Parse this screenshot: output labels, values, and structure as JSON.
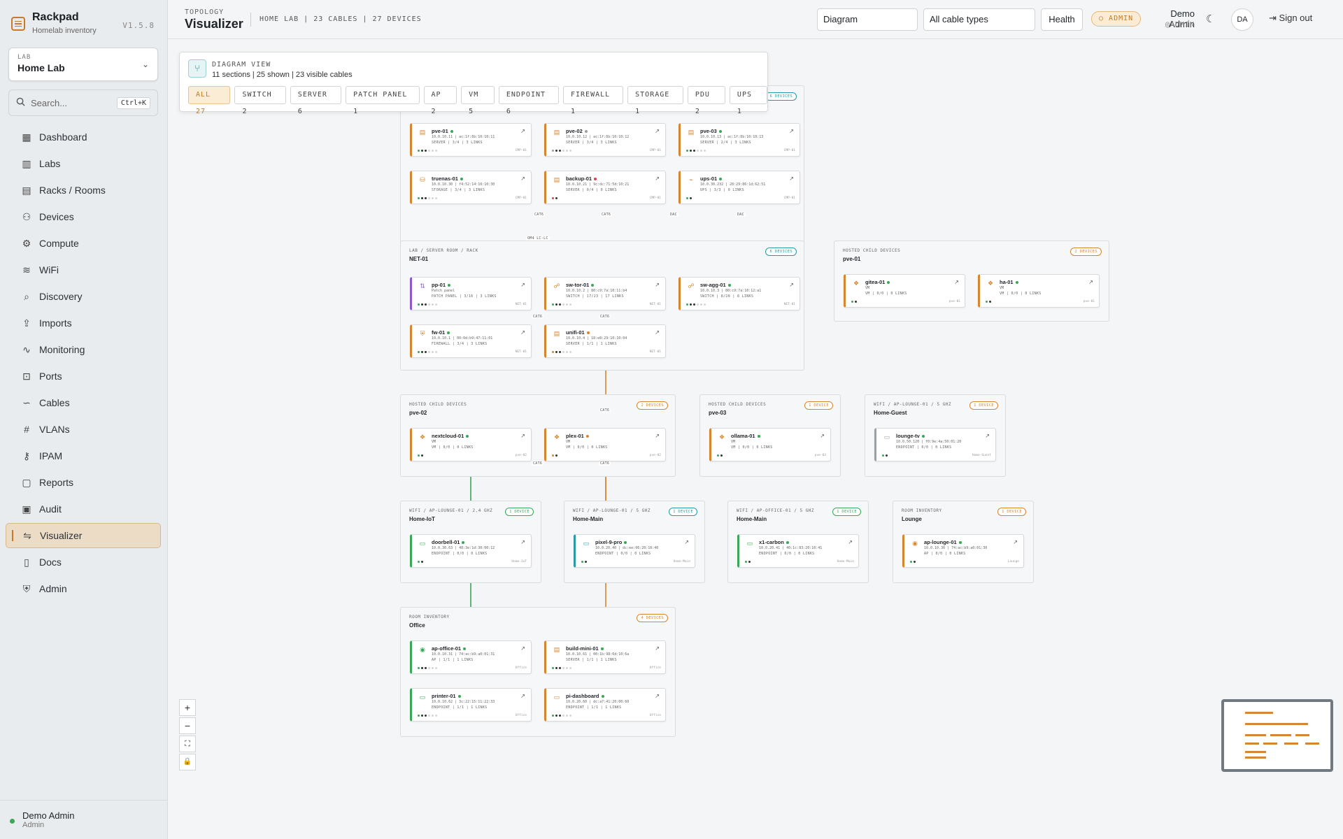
{
  "app": {
    "name": "Rackpad",
    "subtitle": "Homelab inventory",
    "version": "V1.5.8"
  },
  "lab": {
    "label": "LAB",
    "value": "Home Lab"
  },
  "search": {
    "placeholder": "Search...",
    "shortcut": "Ctrl+K"
  },
  "nav": [
    {
      "label": "Dashboard",
      "icon": "dashboard-icon"
    },
    {
      "label": "Labs",
      "icon": "building-icon"
    },
    {
      "label": "Racks / Rooms",
      "icon": "rack-icon"
    },
    {
      "label": "Devices",
      "icon": "devices-icon"
    },
    {
      "label": "Compute",
      "icon": "compute-icon"
    },
    {
      "label": "WiFi",
      "icon": "wifi-icon"
    },
    {
      "label": "Discovery",
      "icon": "search-icon"
    },
    {
      "label": "Imports",
      "icon": "import-icon"
    },
    {
      "label": "Monitoring",
      "icon": "activity-icon"
    },
    {
      "label": "Ports",
      "icon": "port-icon"
    },
    {
      "label": "Cables",
      "icon": "cable-icon"
    },
    {
      "label": "VLANs",
      "icon": "hash-icon"
    },
    {
      "label": "IPAM",
      "icon": "network-icon"
    },
    {
      "label": "Reports",
      "icon": "report-icon"
    },
    {
      "label": "Audit",
      "icon": "audit-icon"
    },
    {
      "label": "Visualizer",
      "icon": "visualizer-icon",
      "active": true
    },
    {
      "label": "Docs",
      "icon": "book-icon"
    },
    {
      "label": "Admin",
      "icon": "shield-icon"
    }
  ],
  "footer_user": {
    "name": "Demo Admin",
    "role": "Admin"
  },
  "header": {
    "crumb": "TOPOLOGY",
    "title": "Visualizer",
    "meta": "HOME LAB | 23 CABLES | 27 DEVICES",
    "view_select": "Diagram",
    "cable_select": "All cable types",
    "health_label": "Health",
    "role_badge": "ADMIN",
    "user_name": "Demo Admin",
    "user_handle": "@ADMIN",
    "avatar": "DA",
    "signout": "Sign out"
  },
  "diagram_panel": {
    "kicker": "DIAGRAM VIEW",
    "summary": "11 sections | 25 shown | 23 visible cables",
    "chips": [
      "ALL 27",
      "SWITCH 2",
      "SERVER 6",
      "PATCH PANEL 1",
      "AP 2",
      "VM 5",
      "ENDPOINT 6",
      "FIREWALL 1",
      "STORAGE 1",
      "PDU 2",
      "UPS 1"
    ]
  },
  "sections": [
    {
      "id": "cmp",
      "tag": "",
      "title": "",
      "badge": "6 DEVICES",
      "color": "#2a9aa0"
    },
    {
      "id": "net",
      "tag": "LAB / SERVER ROOM / RACK",
      "title": "NET-01",
      "badge": "6 DEVICES",
      "color": "#2a9aa0"
    },
    {
      "id": "h1",
      "tag": "HOSTED CHILD DEVICES",
      "title": "pve-01",
      "badge": "2 DEVICES",
      "color": "#d5862f"
    },
    {
      "id": "h2",
      "tag": "HOSTED CHILD DEVICES",
      "title": "pve-02",
      "badge": "2 DEVICES",
      "color": "#d5862f"
    },
    {
      "id": "h3",
      "tag": "HOSTED CHILD DEVICES",
      "title": "pve-03",
      "badge": "1 DEVICE",
      "color": "#d5862f"
    },
    {
      "id": "wg",
      "tag": "WIFI / AP-LOUNGE-01 / 5 GHZ",
      "title": "Home-Guest",
      "badge": "1 DEVICE",
      "color": "#d5862f"
    },
    {
      "id": "wi",
      "tag": "WIFI / AP-LOUNGE-01 / 2.4 GHZ",
      "title": "Home-IoT",
      "badge": "1 DEVICE",
      "color": "#3aa657"
    },
    {
      "id": "wm",
      "tag": "WIFI / AP-LOUNGE-01 / 5 GHZ",
      "title": "Home-Main",
      "badge": "1 DEVICE",
      "color": "#2a9aa0"
    },
    {
      "id": "wo",
      "tag": "WIFI / AP-OFFICE-01 / 5 GHZ",
      "title": "Home-Main",
      "badge": "1 DEVICE",
      "color": "#3aa657"
    },
    {
      "id": "rl",
      "tag": "ROOM INVENTORY",
      "title": "Lounge",
      "badge": "1 DEVICE",
      "color": "#d5862f"
    },
    {
      "id": "ro",
      "tag": "ROOM INVENTORY",
      "title": "Office",
      "badge": "4 DEVICES",
      "color": "#d5862f"
    }
  ],
  "devices": [
    {
      "name": "pve-01",
      "ip": "10.0.10.11 | ac:1f:6b:10:10:11",
      "meta": "SERVER | 3/4 | 3 LINKS",
      "loc": "CMP-01",
      "status": "#3aa657",
      "accent": "#d5862f",
      "icon": "▤"
    },
    {
      "name": "pve-02",
      "ip": "10.0.10.12 | ac:1f:6b:10:10:12",
      "meta": "SERVER | 3/4 | 3 LINKS",
      "loc": "CMP-01",
      "status": "#9aa0a6",
      "accent": "#d5862f",
      "icon": "▤"
    },
    {
      "name": "pve-03",
      "ip": "10.0.10.13 | ac:1f:6b:10:10:13",
      "meta": "SERVER | 2/4 | 3 LINKS",
      "loc": "CMP-01",
      "status": "#3aa657",
      "accent": "#d5862f",
      "icon": "▤"
    },
    {
      "name": "truenas-01",
      "ip": "10.0.10.30 | f4:52:14:10:10:30",
      "meta": "STORAGE | 3/4 | 3 LINKS",
      "loc": "CMP-01",
      "status": "#3aa657",
      "accent": "#d5862f",
      "icon": "⛁"
    },
    {
      "name": "backup-01",
      "ip": "10.0.10.21 | 9c:dc:71:5d:10:21",
      "meta": "SERVER | 0/4 | 0 LINKS",
      "loc": "CMP-01",
      "status": "#d64545",
      "accent": "#d5862f",
      "icon": "▤"
    },
    {
      "name": "ups-01",
      "ip": "10.0.30.232 | 28:29:86:1d:62:51",
      "meta": "UPS | 3/3 | 0 LINKS",
      "loc": "CMP-01",
      "status": "#3aa657",
      "accent": "#d5862f",
      "icon": "⌁"
    },
    {
      "name": "pp-01",
      "ip": "Patch panel",
      "meta": "PATCH PANEL | 3/16 | 3 LINKS",
      "loc": "NET-01",
      "status": "#3aa657",
      "accent": "#9057c9",
      "icon": "⇅"
    },
    {
      "name": "sw-tor-01",
      "ip": "10.0.10.2 | 80:c9:7a:10:11:b4",
      "meta": "SWITCH | 17/23 | 17 LINKS",
      "loc": "NET-01",
      "status": "#3aa657",
      "accent": "#d5862f",
      "icon": "☍"
    },
    {
      "name": "sw-agg-01",
      "ip": "10.0.10.3 | 80:c9:7a:10:12:a1",
      "meta": "SWITCH | 8/28 | 8 LINKS",
      "loc": "NET-01",
      "status": "#3aa657",
      "accent": "#d5862f",
      "icon": "☍"
    },
    {
      "name": "fw-01",
      "ip": "10.0.10.1 | 00:0d:b9:47:11:01",
      "meta": "FIREWALL | 3/4 | 3 LINKS",
      "loc": "NET-01",
      "status": "#3aa657",
      "accent": "#d5862f",
      "icon": "⛨"
    },
    {
      "name": "unifi-01",
      "ip": "10.0.10.4 | 18:e8:29:10:10:04",
      "meta": "SERVER | 1/1 | 1 LINKS",
      "loc": "NET-01",
      "status": "#d5862f",
      "accent": "#d5862f",
      "icon": "▤"
    },
    {
      "name": "gitea-01",
      "ip": "VM",
      "meta": "VM | 0/0 | 0 LINKS",
      "loc": "pve-01",
      "status": "#3aa657",
      "accent": "#d5862f",
      "icon": "❖"
    },
    {
      "name": "ha-01",
      "ip": "VM",
      "meta": "VM | 0/0 | 0 LINKS",
      "loc": "pve-01",
      "status": "#3aa657",
      "accent": "#d5862f",
      "icon": "❖"
    },
    {
      "name": "nextcloud-01",
      "ip": "VM",
      "meta": "VM | 0/0 | 0 LINKS",
      "loc": "pve-02",
      "status": "#3aa657",
      "accent": "#d5862f",
      "icon": "❖"
    },
    {
      "name": "plex-01",
      "ip": "VM",
      "meta": "VM | 0/0 | 0 LINKS",
      "loc": "pve-02",
      "status": "#d5862f",
      "accent": "#d5862f",
      "icon": "❖"
    },
    {
      "name": "ollama-01",
      "ip": "VM",
      "meta": "VM | 0/0 | 0 LINKS",
      "loc": "pve-03",
      "status": "#3aa657",
      "accent": "#d5862f",
      "icon": "❖"
    },
    {
      "name": "lounge-tv",
      "ip": "10.0.50.120 | f0:9e:4a:50:01:20",
      "meta": "ENDPOINT | 0/0 | 0 LINKS",
      "loc": "Home-Guest",
      "status": "#3aa657",
      "accent": "#9aa0a6",
      "icon": "▭"
    },
    {
      "name": "doorbell-01",
      "ip": "10.0.30.63 | 48:3e:1d:30:00:12",
      "meta": "ENDPOINT | 0/0 | 0 LINKS",
      "loc": "Home-IoT",
      "status": "#3aa657",
      "accent": "#3aa657",
      "icon": "▭"
    },
    {
      "name": "pixel-9-pro",
      "ip": "10.0.20.40 | dc:ee:06:20:10:40",
      "meta": "ENDPOINT | 0/0 | 0 LINKS",
      "loc": "Home-Main",
      "status": "#3aa657",
      "accent": "#2a9aa0",
      "icon": "▭"
    },
    {
      "name": "x1-carbon",
      "ip": "10.0.20.41 | 40:1c:83:20:10:41",
      "meta": "ENDPOINT | 0/0 | 0 LINKS",
      "loc": "Home-Main",
      "status": "#3aa657",
      "accent": "#3aa657",
      "icon": "▭"
    },
    {
      "name": "ap-lounge-01",
      "ip": "10.0.10.30 | 74:ac:b9:a0:01:30",
      "meta": "AP | 0/0 | 0 LINKS",
      "loc": "Lounge",
      "status": "#3aa657",
      "accent": "#d5862f",
      "icon": "◉"
    },
    {
      "name": "ap-office-01",
      "ip": "10.0.10.31 | 74:ac:b9:a0:01:31",
      "meta": "AP | 1/1 | 1 LINKS",
      "loc": "Office",
      "status": "#3aa657",
      "accent": "#3aa657",
      "icon": "◉"
    },
    {
      "name": "build-mini-01",
      "ip": "10.0.10.61 | 00:1b:98:6d:10:6a",
      "meta": "SERVER | 1/1 | 1 LINKS",
      "loc": "Office",
      "status": "#3aa657",
      "accent": "#d5862f",
      "icon": "▤"
    },
    {
      "name": "printer-01",
      "ip": "10.0.10.62 | 3c:22:15:11:22:33",
      "meta": "ENDPOINT | 1/1 | 1 LINKS",
      "loc": "Office",
      "status": "#3aa657",
      "accent": "#3aa657",
      "icon": "▭"
    },
    {
      "name": "pi-dashboard",
      "ip": "10.0.20.60 | dc:a7:41:20:00:60",
      "meta": "ENDPOINT | 1/1 | 1 LINKS",
      "loc": "Office",
      "status": "#3aa657",
      "accent": "#d5862f",
      "icon": "▭"
    }
  ],
  "cable_labels": [
    "CAT6",
    "CAT6",
    "DAC",
    "DAC",
    "OM4 LC-LC",
    "CAT6",
    "CAT6",
    "CAT6",
    "CAT6",
    "CAT6",
    "CAT6"
  ],
  "zoom_controls": [
    "+",
    "−",
    "⛶",
    "🔒"
  ]
}
